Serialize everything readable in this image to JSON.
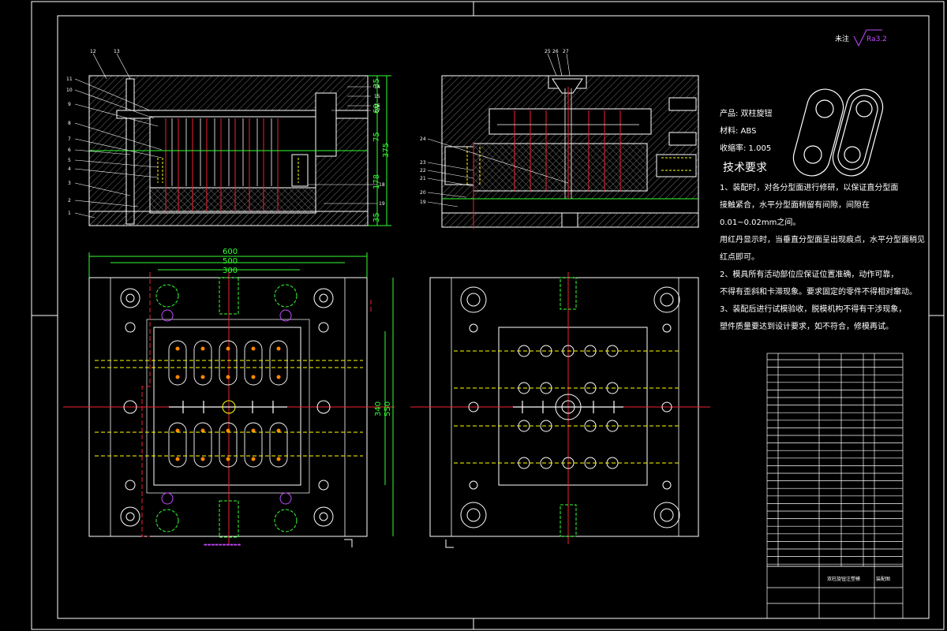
{
  "drawing": {
    "roughness_label": "未注",
    "roughness_value": "Ra3.2",
    "product_label": "产品: 双柱旋钮",
    "material_label": "材料: ABS",
    "shrinkage_label": "收缩率: 1.005",
    "tech_title": "技术要求",
    "tech_lines": [
      "1、装配时，对各分型面进行修研，以保证直分型面",
      "接触紧合，水平分型面稍留有间隙，间隙在",
      "0.01~0.02mm之间。",
      "用红丹显示时，当垂直分型面呈出现痕点，水平分型面稍见",
      "红点即可。",
      "2、模具所有活动部位应保证位置准确，动作可靠，",
      "不得有歪斜和卡滞现象。要求固定的零件不得相对窜动。",
      "3、装配后进行试模验收，脱模机构不得有干涉现象，",
      "塑件质量要达到设计要求，如不符合，修模再试。"
    ]
  },
  "dimensions": {
    "plan_width_outer": "600",
    "plan_width_mid": "500",
    "plan_width_inner": "300",
    "plan_height_inner": "340",
    "plan_height_outer": "550",
    "section_total": "375",
    "section_seg1": "35",
    "section_seg2": "60",
    "section_seg3": "75",
    "section_seg4": "178",
    "section_seg5": "35"
  },
  "leader_numbers_left": [
    "11",
    "10",
    "9",
    "8",
    "7",
    "6",
    "5",
    "4",
    "3",
    "2",
    "1"
  ],
  "leader_numbers_top": [
    "12",
    "13"
  ],
  "leader_numbers_right": [
    "14",
    "15",
    "16",
    "17",
    "18",
    "19"
  ],
  "leader_numbers_mid_top": [
    "25",
    "26",
    "27"
  ],
  "leader_numbers_mid_left": [
    "24",
    "23",
    "22",
    "21",
    "20",
    "19"
  ],
  "title_block": {
    "drawing_name": "双柱旋钮注塑模",
    "part_label": "装配图"
  }
}
